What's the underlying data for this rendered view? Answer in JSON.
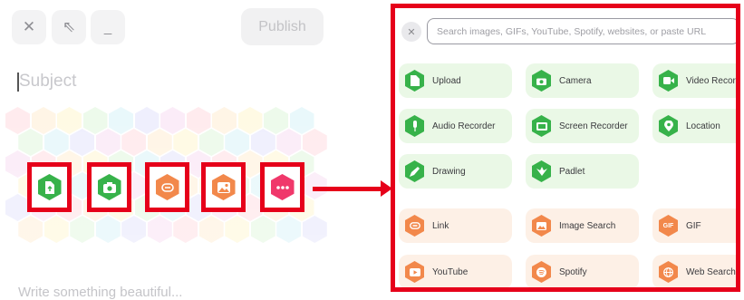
{
  "composer": {
    "subject_placeholder": "Subject",
    "body_placeholder": "Write something beautiful...",
    "publish_label": "Publish",
    "controls": [
      {
        "name": "close",
        "glyph": "✕",
        "icon": "close-icon"
      },
      {
        "name": "expand",
        "glyph": "⇖",
        "icon": "expand-icon"
      },
      {
        "name": "minimize",
        "glyph": "_",
        "icon": "minimize-icon"
      }
    ],
    "attach_buttons": [
      {
        "icon": "upload-icon",
        "color": "#37b24a"
      },
      {
        "icon": "camera-icon",
        "color": "#37b24a"
      },
      {
        "icon": "link-icon",
        "color": "#f2884b"
      },
      {
        "icon": "image-search-icon",
        "color": "#f2884b"
      },
      {
        "icon": "more-icon",
        "color": "#f0386b"
      }
    ]
  },
  "attachment_panel": {
    "close_glyph": "✕",
    "search_placeholder": "Search images, GIFs, YouTube, Spotify, websites, or paste URL",
    "options": [
      {
        "label": "Upload",
        "group": "green",
        "icon": "upload-icon"
      },
      {
        "label": "Camera",
        "group": "green",
        "icon": "camera-icon"
      },
      {
        "label": "Video Recorder",
        "group": "green",
        "icon": "video-recorder-icon"
      },
      {
        "label": "Audio Recorder",
        "group": "green",
        "icon": "microphone-icon"
      },
      {
        "label": "Screen Recorder",
        "group": "green",
        "icon": "screen-recorder-icon"
      },
      {
        "label": "Location",
        "group": "green",
        "icon": "location-icon"
      },
      {
        "label": "Drawing",
        "group": "green",
        "icon": "drawing-icon"
      },
      {
        "label": "Padlet",
        "group": "green",
        "icon": "padlet-icon"
      },
      {
        "label": "Link",
        "group": "orange",
        "icon": "link-icon"
      },
      {
        "label": "Image Search",
        "group": "orange",
        "icon": "image-search-icon"
      },
      {
        "label": "GIF",
        "group": "orange",
        "icon": "gif-icon"
      },
      {
        "label": "YouTube",
        "group": "orange",
        "icon": "youtube-icon"
      },
      {
        "label": "Spotify",
        "group": "orange",
        "icon": "spotify-icon"
      },
      {
        "label": "Web Search",
        "group": "orange",
        "icon": "web-search-icon"
      }
    ]
  },
  "colors": {
    "highlight": "#e6001a",
    "green": "#37b24a",
    "orange": "#f2884b",
    "pink": "#f0386b"
  }
}
